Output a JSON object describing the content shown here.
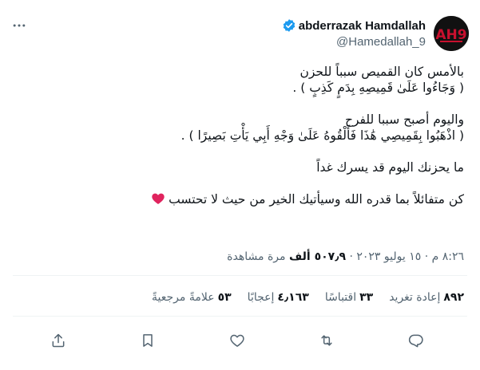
{
  "author": {
    "display_name": "abderrazak Hamdallah",
    "handle": "@Hamedallah_9",
    "verified": true,
    "avatar_bg": "#111111",
    "avatar_accent": "#c8102e"
  },
  "tweet": {
    "lines": [
      "بالأمس كان القميص سبباً للحزن",
      "( وَجَاءُوا عَلَىٰ قَمِيصِهِ بِدَمٍ كَذِبٍ ) .",
      "",
      "واليوم أصبح سببا للفرح",
      "( اذْهَبُوا بِقَمِيصِي هَٰذَا فَأَلْقُوهُ عَلَىٰ وَجْهِ أَبِي يَأْتِ بَصِيرًا ) .",
      "",
      "ما يحزنك اليوم قد يسرك غداً",
      "",
      "كن متفائلاً بما قدره الله وسيأتيك الخير من حيث لا تحتسب"
    ],
    "heart_emoji": "red-heart"
  },
  "meta": {
    "timestamp": "٨:٢٦ م · ١٥ يوليو ٢٠٢٣ ·",
    "views_count": "٥٠٧٫٩ ألف",
    "views_label": "مرة مشاهدة"
  },
  "stats": [
    {
      "count": "٨٩٢",
      "label": "إعادة تغريد"
    },
    {
      "count": "٣٣",
      "label": "اقتباسًا"
    },
    {
      "count": "٤٫١٦٣",
      "label": "إعجابًا"
    },
    {
      "count": "٥٣",
      "label": "علامةً مرجعيةً"
    }
  ],
  "actions": [
    "share-icon",
    "bookmark-icon",
    "like-icon",
    "retweet-icon",
    "reply-icon"
  ],
  "colors": {
    "text_primary": "#0f1419",
    "text_secondary": "#536471",
    "verified_blue": "#1d9bf0",
    "heart_red": "#e0245e",
    "divider": "#eff3f4"
  }
}
